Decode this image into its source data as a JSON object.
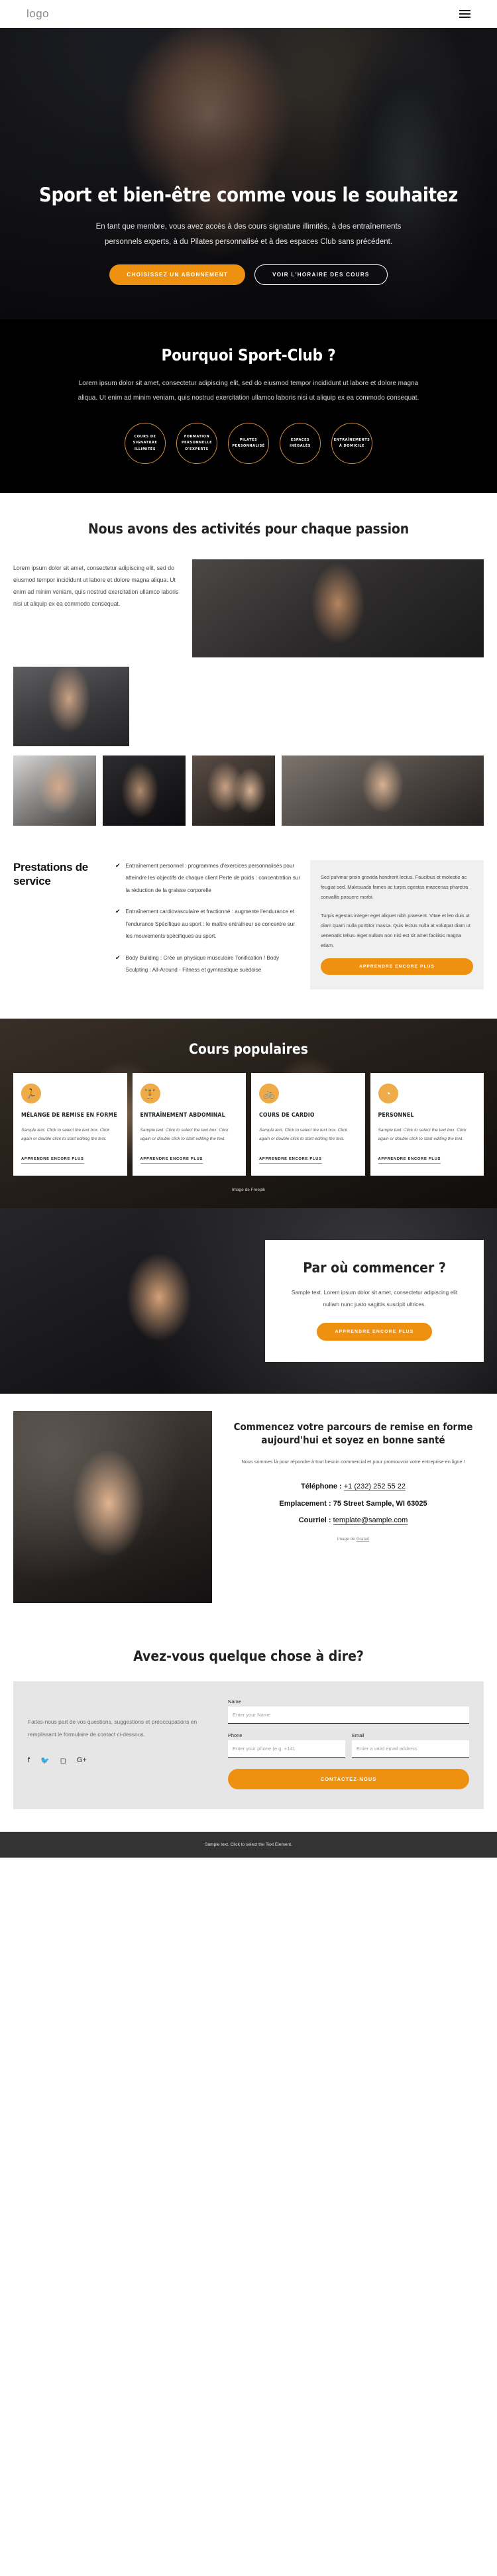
{
  "header": {
    "logo": "logo",
    "menu_icon": "hamburger-menu-icon"
  },
  "hero": {
    "title": "Sport et bien-être comme vous le souhaitez",
    "paragraph": "En tant que membre, vous avez accès à des cours signature illimités, à des entraînements personnels experts, à du Pilates personnalisé et à des espaces Club sans précédent.",
    "primary_button": "Choisissez un abonnement",
    "secondary_button": "Voir l'horaire des cours"
  },
  "why": {
    "title": "Pourquoi Sport-Club ?",
    "paragraph": "Lorem ipsum dolor sit amet, consectetur adipiscing elit, sed do eiusmod tempor incididunt ut labore et dolore magna aliqua. Ut enim ad minim veniam, quis nostrud exercitation ullamco laboris nisi ut aliquip ex ea commodo consequat.",
    "badges": [
      "Cours de signature illimités",
      "Formation personnelle d'experts",
      "Pilates personnalisé",
      "Espaces inégalés",
      "Entraînements à domicile"
    ]
  },
  "activities": {
    "title": "Nous avons des activités pour chaque passion",
    "paragraph": "Lorem ipsum dolor sit amet, consectetur adipiscing elit, sed do eiusmod tempor incididunt ut labore et dolore magna aliqua. Ut enim ad minim veniam, quis nostrud exercitation ullamco laboris nisi ut aliquip ex ea commodo consequat."
  },
  "prestations": {
    "title": "Prestations de service",
    "items": [
      "Entraînement personnel : programmes d'exercices personnalisés pour atteindre les objectifs de chaque client Perte de poids : concentration sur la réduction de la graisse corporelle",
      "Entraînement cardiovasculaire et fractionné : augmente l'endurance et l'endurance Spécifique au sport : le maître entraîneur se concentre sur les mouvements spécifiques au sport.",
      "Body Building : Crée un physique musculaire Tonification / Body Sculpting : All-Around - Fitness et gymnastique suédoise"
    ],
    "check_icon": "check-icon",
    "panel_p1": "Sed pulvinar proin gravida hendrerit lectus. Faucibus et molestie ac feugiat sed. Malesuada fames ac turpis egestas maecenas pharetra convallis posuere morbi.",
    "panel_p2": "Turpis egestas integer eget aliquet nibh praesent. Vitae et leo duis ut diam quam nulla porttitor massa. Quis lectus nulla at volutpat diam ut venenatis tellus. Eget nullam non nisi est sit amet facilisis magna etiam.",
    "panel_button": "Apprendre encore plus"
  },
  "popular": {
    "title": "Cours populaires",
    "image_credit": "Image de Freepik",
    "cards": [
      {
        "icon": "runner-icon",
        "title": "Mélange de remise en forme",
        "text": "Sample text. Click to select the text box. Click again or double click to start editing the text.",
        "link": "Apprendre encore plus"
      },
      {
        "icon": "dumbbell-icon",
        "title": "Entraînement abdominal",
        "text": "Sample text. Click to select the text box. Click again or double click to start editing the text.",
        "link": "Apprendre encore plus"
      },
      {
        "icon": "bike-icon",
        "title": "Cours de cardio",
        "text": "Sample text. Click to select the text box. Click again or double click to start editing the text.",
        "link": "Apprendre encore plus"
      },
      {
        "icon": "kettlebell-icon",
        "title": "Personnel",
        "text": "Sample text. Click to select the text box. Click again or double click to start editing the text.",
        "link": "Apprendre encore plus"
      }
    ]
  },
  "start": {
    "title": "Par où commencer ?",
    "paragraph": "Sample text. Lorem ipsum dolor sit amet, consectetur adipiscing elit nullam nunc justo sagittis suscipit ultrices.",
    "button": "Apprendre encore plus"
  },
  "contact": {
    "title": "Commencez votre parcours de remise en forme aujourd'hui et soyez en bonne santé",
    "subtitle": "Nous sommes là pour répondre à tout besoin commercial et pour promouvoir votre entreprise en ligne !",
    "phone_label": "Téléphone :",
    "phone_value": "+1 (232) 252 55 22",
    "location_label": "Emplacement :",
    "location_value": "75 Street Sample, WI 63025",
    "email_label": "Courriel :",
    "email_value": "template@sample.com",
    "credit_prefix": "Image de",
    "credit_link": "Gratuit"
  },
  "say": {
    "title": "Avez-vous quelque chose à dire?",
    "intro": "Faites-nous part de vos questions, suggestions et préoccupations en remplissant le formulaire de contact ci-dessous.",
    "socials": [
      {
        "name": "facebook-icon",
        "glyph": "f"
      },
      {
        "name": "twitter-icon",
        "glyph": "🐦"
      },
      {
        "name": "instagram-icon",
        "glyph": "◻"
      },
      {
        "name": "google-plus-icon",
        "glyph": "G+"
      }
    ],
    "name_label": "Name",
    "name_placeholder": "Enter your Name",
    "name_value": "",
    "phone_label": "Phone",
    "phone_placeholder": "Enter your phone (e.g. +141",
    "phone_value": "",
    "email_label": "Email",
    "email_placeholder": "Enter a valid email address",
    "email_value": "",
    "submit": "Contactez-nous"
  },
  "footer": {
    "text": "Sample text. Click to select the Text Element."
  },
  "colors": {
    "accent": "#ef9110",
    "accent_light": "#f0ab49",
    "dark": "#000000",
    "footer": "#333333"
  }
}
